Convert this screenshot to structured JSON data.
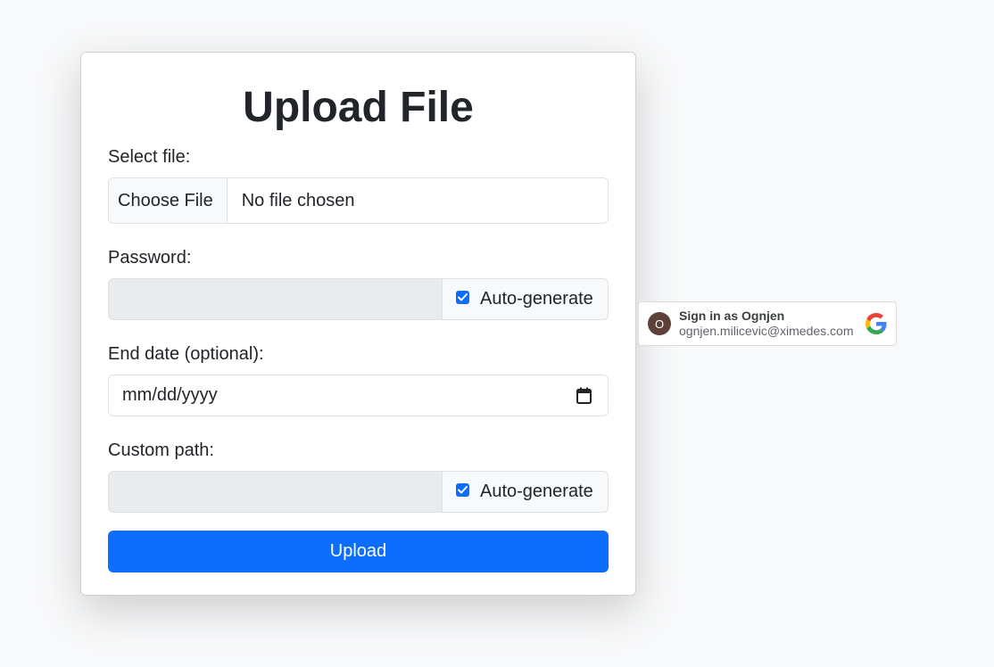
{
  "form": {
    "title": "Upload File",
    "file_label": "Select file:",
    "file_button": "Choose File",
    "file_status": "No file chosen",
    "password_label": "Password:",
    "password_autogen_label": "Auto-generate",
    "password_autogen_checked": true,
    "end_date_label": "End date (optional):",
    "end_date_placeholder": "mm/dd/yyyy",
    "custom_path_label": "Custom path:",
    "custom_path_autogen_label": "Auto-generate",
    "custom_path_autogen_checked": true,
    "upload_button": "Upload"
  },
  "google_signin": {
    "avatar_initial": "O",
    "title": "Sign in as Ognjen",
    "email": "ognjen.milicevic@ximedes.com",
    "icon": "google-logo-icon"
  },
  "colors": {
    "primary": "#0d6efd",
    "background": "#f8f9fa",
    "disabled_input": "#e9ecef",
    "avatar": "#5d4037"
  }
}
